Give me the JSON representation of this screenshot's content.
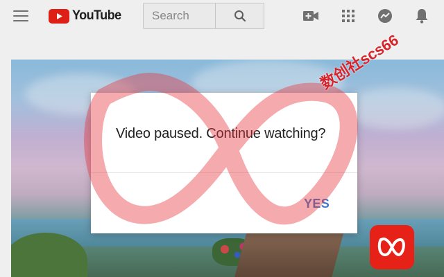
{
  "header": {
    "logo_text": "YouTube",
    "search": {
      "placeholder": "Search"
    }
  },
  "icons": {
    "menu": "hamburger-menu-icon",
    "search": "magnifier-icon",
    "create": "video-camera-plus-icon",
    "apps": "apps-grid-icon",
    "messages": "chat-bubble-icon",
    "notifications": "bell-icon"
  },
  "dialog": {
    "message": "Video paused. Continue watching?",
    "confirm_label": "YES"
  },
  "watermark": {
    "text": "数创社scs66"
  },
  "colors": {
    "brand_red": "#e62117",
    "accent_blue": "#3f78c9",
    "watermark_red": "#d8232a"
  }
}
